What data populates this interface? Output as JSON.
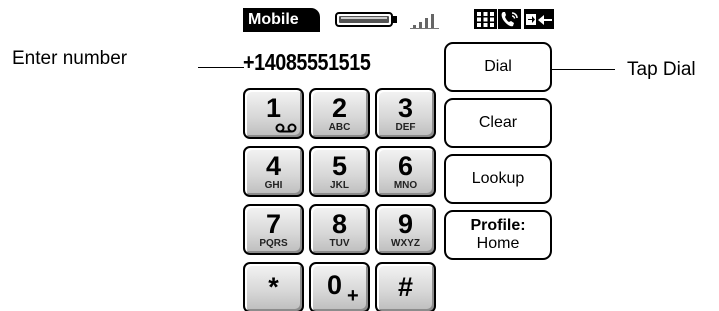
{
  "callouts": {
    "left": "Enter number",
    "right": "Tap Dial"
  },
  "titlebar": {
    "title": "Mobile",
    "icons": [
      "battery-icon",
      "signal-icon",
      "app-grid-icon",
      "phone-icon",
      "transfer-icon"
    ]
  },
  "number_field": {
    "value": "+14085551515"
  },
  "keypad": {
    "keys": [
      {
        "digit": "1",
        "letters": "",
        "icon": "voicemail-icon"
      },
      {
        "digit": "2",
        "letters": "ABC"
      },
      {
        "digit": "3",
        "letters": "DEF"
      },
      {
        "digit": "4",
        "letters": "GHI"
      },
      {
        "digit": "5",
        "letters": "JKL"
      },
      {
        "digit": "6",
        "letters": "MNO"
      },
      {
        "digit": "7",
        "letters": "PQRS"
      },
      {
        "digit": "8",
        "letters": "TUV"
      },
      {
        "digit": "9",
        "letters": "WXYZ"
      },
      {
        "digit": "*",
        "letters": ""
      },
      {
        "digit": "0",
        "letters": "",
        "sub": "+"
      },
      {
        "digit": "#",
        "letters": ""
      }
    ]
  },
  "buttons": {
    "dial": "Dial",
    "clear": "Clear",
    "lookup": "Lookup",
    "profile_label": "Profile:",
    "profile_value": "Home"
  }
}
